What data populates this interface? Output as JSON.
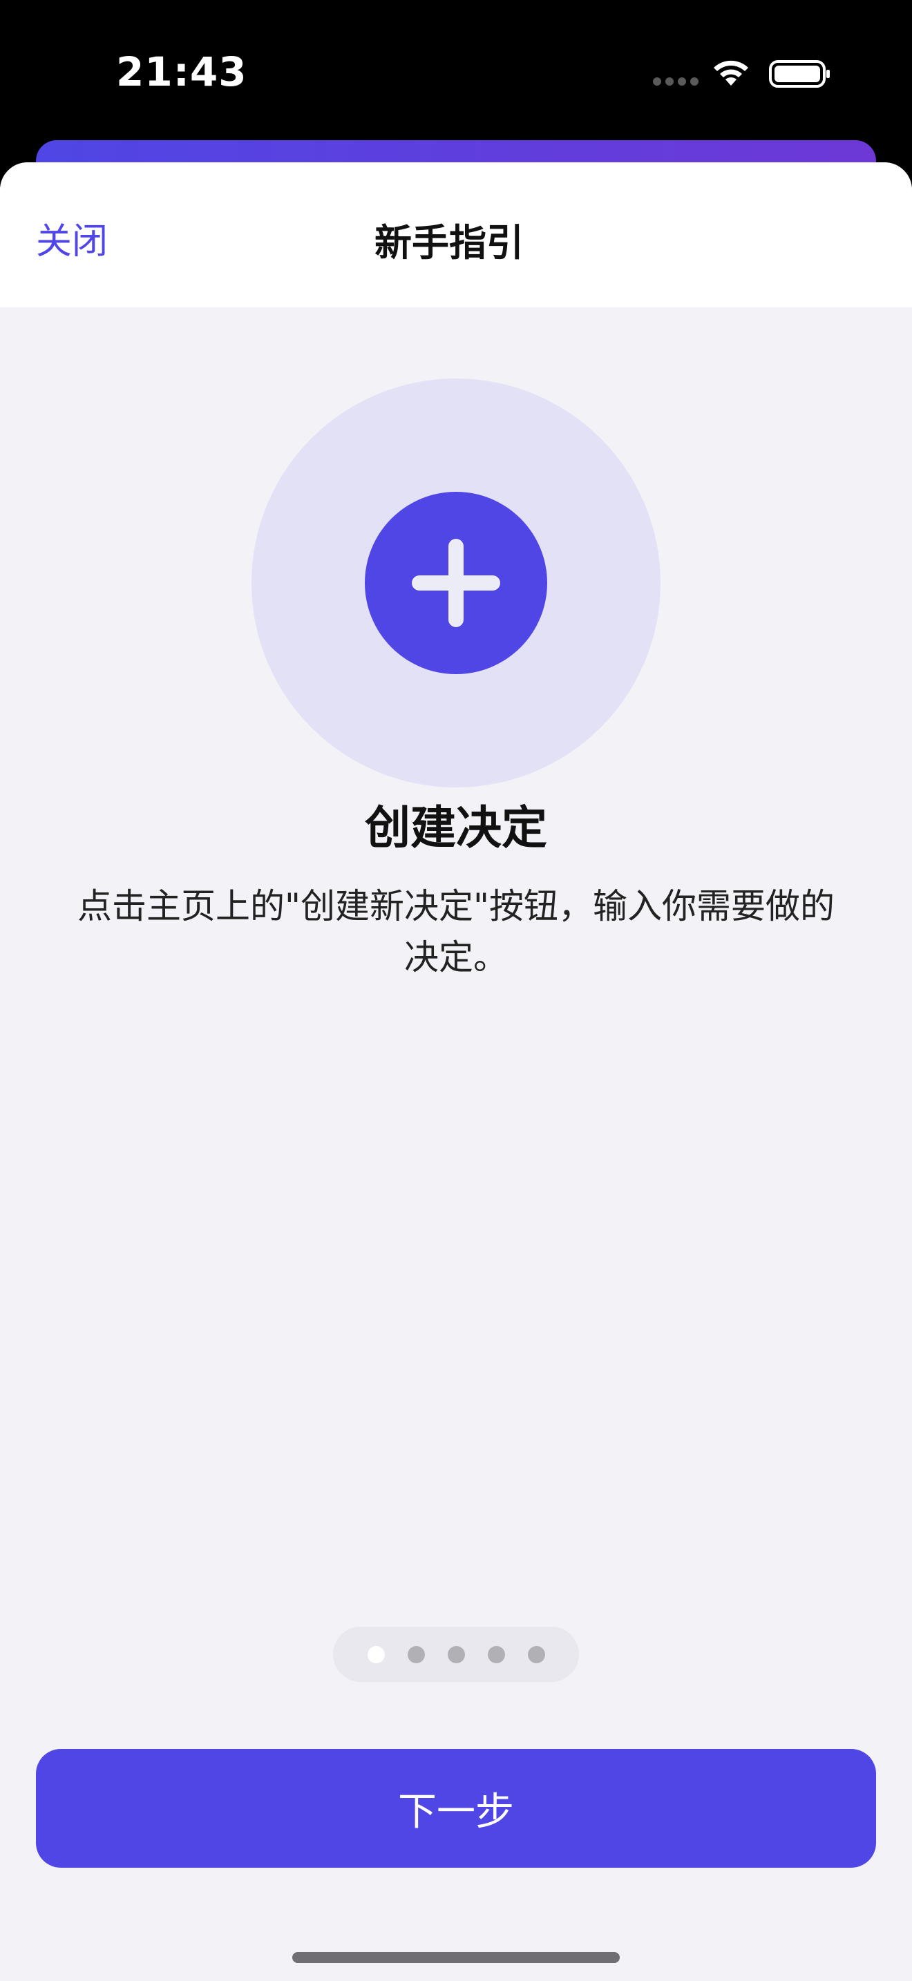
{
  "status_bar": {
    "time": "21:43"
  },
  "nav": {
    "close_label": "关闭",
    "title": "新手指引"
  },
  "step": {
    "icon": "plus-icon",
    "title": "创建决定",
    "description": "点击主页上的\"创建新决定\"按钮，输入你需要做的决定。"
  },
  "pagination": {
    "total": 5,
    "current": 1
  },
  "actions": {
    "next_label": "下一步"
  },
  "colors": {
    "accent": "#5046e5",
    "hero_bg": "#e3e1f6",
    "sheet_bg": "#f2f2f7"
  }
}
